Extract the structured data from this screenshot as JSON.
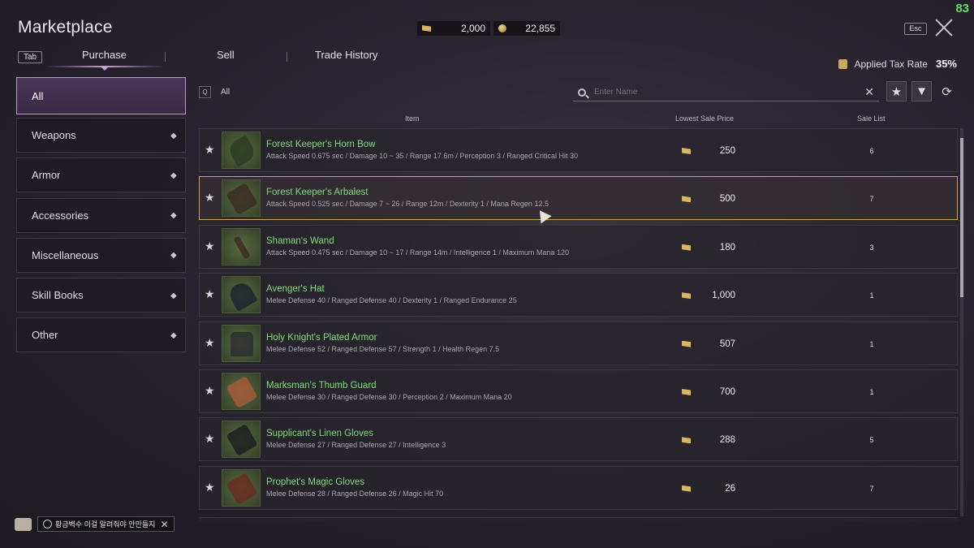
{
  "header": {
    "title": "Marketplace",
    "fps": "83",
    "currency_ticket": "2,000",
    "currency_gold": "22,855",
    "esc_label": "Esc"
  },
  "tabs": {
    "key_label": "Tab",
    "purchase": "Purchase",
    "sell": "Sell",
    "history": "Trade History"
  },
  "tax": {
    "label": "Applied Tax Rate",
    "rate": "35%"
  },
  "sidebar": {
    "items": [
      {
        "label": "All"
      },
      {
        "label": "Weapons"
      },
      {
        "label": "Armor"
      },
      {
        "label": "Accessories"
      },
      {
        "label": "Miscellaneous"
      },
      {
        "label": "Skill Books"
      },
      {
        "label": "Other"
      }
    ]
  },
  "filter": {
    "key": "Q",
    "value": "All"
  },
  "search": {
    "placeholder": "Enter Name"
  },
  "table": {
    "headers": {
      "item": "Item",
      "price": "Lowest Sale Price",
      "count": "Sale List"
    },
    "rows": [
      {
        "name": "Forest Keeper's Horn Bow",
        "stats": "Attack Speed 0.675 sec / Damage 10 ~ 35 / Range 17.6m / Perception 3 / Ranged Critical Hit 30",
        "price": "250",
        "count": "6"
      },
      {
        "name": "Forest Keeper's Arbalest",
        "stats": "Attack Speed 0.525 sec / Damage 7 ~ 26 / Range 12m / Dexterity 1 / Mana Regen 12.5",
        "price": "500",
        "count": "7"
      },
      {
        "name": "Shaman's Wand",
        "stats": "Attack Speed 0.475 sec / Damage 10 ~ 17 / Range 14m / Intelligence 1 / Maximum Mana 120",
        "price": "180",
        "count": "3"
      },
      {
        "name": "Avenger's Hat",
        "stats": "Melee Defense 40 / Ranged Defense 40 / Dexterity 1 / Ranged Endurance 25",
        "price": "1,000",
        "count": "1"
      },
      {
        "name": "Holy Knight's Plated Armor",
        "stats": "Melee Defense 52 / Ranged Defense 57 / Strength 1 / Health Regen 7.5",
        "price": "507",
        "count": "1"
      },
      {
        "name": "Marksman's Thumb Guard",
        "stats": "Melee Defense 30 / Ranged Defense 30 / Perception 2 / Maximum Mana 20",
        "price": "700",
        "count": "1"
      },
      {
        "name": "Supplicant's Linen Gloves",
        "stats": "Melee Defense 27 / Ranged Defense 27 / Intelligence 3",
        "price": "288",
        "count": "5"
      },
      {
        "name": "Prophet's Magic Gloves",
        "stats": "Melee Defense 28 / Ranged Defense 26 / Magic Hit 70",
        "price": "26",
        "count": "7"
      }
    ]
  },
  "chat": {
    "notice": "황금벽수 이걸 알려줘야 안만들지"
  },
  "colors": {
    "item_name": "#7fdb7a",
    "selected_border": "#c8a25a",
    "fps": "#5fe05f"
  }
}
